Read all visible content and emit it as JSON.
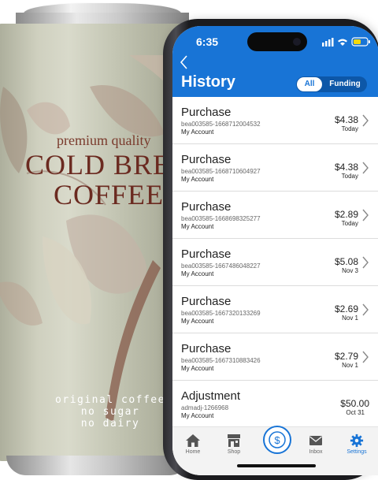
{
  "can": {
    "tagline": "premium quality",
    "brand_line1": "COLD BRE",
    "brand_line2": "COFFEE",
    "footer": [
      "original coffee",
      "no sugar",
      "no dairy"
    ]
  },
  "status_bar": {
    "time": "6:35"
  },
  "header": {
    "back_icon": "chevron-left-icon",
    "title": "History",
    "filter_tabs": [
      {
        "label": "All",
        "selected": true
      },
      {
        "label": "Funding",
        "selected": false
      }
    ]
  },
  "transactions": [
    {
      "type": "Purchase",
      "id": "bea003585-1668712004532",
      "account": "My Account",
      "amount": "$4.38",
      "date": "Today",
      "has_chevron": true
    },
    {
      "type": "Purchase",
      "id": "bea003585-1668710604927",
      "account": "My Account",
      "amount": "$4.38",
      "date": "Today",
      "has_chevron": true
    },
    {
      "type": "Purchase",
      "id": "bea003585-1668698325277",
      "account": "My Account",
      "amount": "$2.89",
      "date": "Today",
      "has_chevron": true
    },
    {
      "type": "Purchase",
      "id": "bea003585-1667486048227",
      "account": "My Account",
      "amount": "$5.08",
      "date": "Nov 3",
      "has_chevron": true
    },
    {
      "type": "Purchase",
      "id": "bea003585-1667320133269",
      "account": "My Account",
      "amount": "$2.69",
      "date": "Nov 1",
      "has_chevron": true
    },
    {
      "type": "Purchase",
      "id": "bea003585-1667310883426",
      "account": "My Account",
      "amount": "$2.79",
      "date": "Nov 1",
      "has_chevron": true
    },
    {
      "type": "Adjustment",
      "id": "admadj-1266968",
      "account": "My Account",
      "amount": "$50.00",
      "date": "Oct 31",
      "has_chevron": false
    }
  ],
  "tab_bar": [
    {
      "label": "Home",
      "icon": "home-icon"
    },
    {
      "label": "Shop",
      "icon": "shop-icon"
    },
    {
      "label": "",
      "icon": "dollar-circle-icon"
    },
    {
      "label": "Inbox",
      "icon": "mail-icon"
    },
    {
      "label": "Settings",
      "icon": "gear-icon",
      "active": true
    }
  ],
  "colors": {
    "accent": "#1874d6",
    "header_bg": "#1874d6",
    "can_text": "#6b2a20",
    "tab_inactive": "#666666"
  }
}
